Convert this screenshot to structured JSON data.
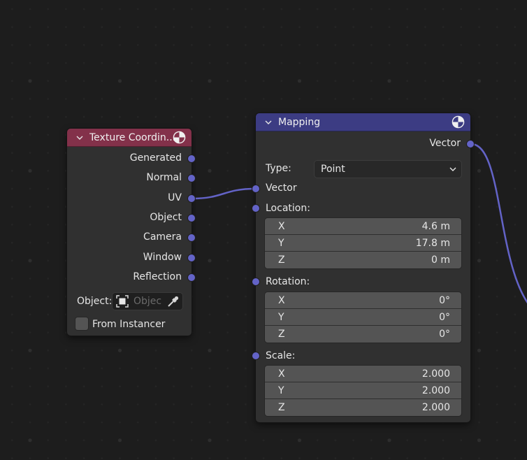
{
  "colors": {
    "background": "#1d1d1d",
    "node_body": "#303030",
    "texture_header": "#83314a",
    "mapping_header": "#3c3c83",
    "socket_vector": "#6363c7",
    "link": "#6363c7"
  },
  "texture_node": {
    "title": "Texture Coordin...",
    "collapse_icon": "chevron-down-icon",
    "preview_icon": "material-preview-icon",
    "outputs": [
      "Generated",
      "Normal",
      "UV",
      "Object",
      "Camera",
      "Window",
      "Reflection"
    ],
    "object_label": "Object:",
    "object_placeholder": "Objec",
    "object_icon": "object-selector-icon",
    "eyedropper_icon": "eyedropper-icon",
    "from_instancer_label": "From Instancer",
    "from_instancer_checked": false
  },
  "mapping_node": {
    "title": "Mapping",
    "collapse_icon": "chevron-down-icon",
    "preview_icon": "material-preview-icon",
    "output_vector": "Vector",
    "type_label": "Type:",
    "type_value": "Point",
    "input_vector": "Vector",
    "location": {
      "label": "Location:",
      "fields": [
        {
          "axis": "X",
          "value": "4.6 m"
        },
        {
          "axis": "Y",
          "value": "17.8 m"
        },
        {
          "axis": "Z",
          "value": "0 m"
        }
      ]
    },
    "rotation": {
      "label": "Rotation:",
      "fields": [
        {
          "axis": "X",
          "value": "0°"
        },
        {
          "axis": "Y",
          "value": "0°"
        },
        {
          "axis": "Z",
          "value": "0°"
        }
      ]
    },
    "scale": {
      "label": "Scale:",
      "fields": [
        {
          "axis": "X",
          "value": "2.000"
        },
        {
          "axis": "Y",
          "value": "2.000"
        },
        {
          "axis": "Z",
          "value": "2.000"
        }
      ]
    }
  },
  "links": [
    {
      "from": "Texture Coordinate.UV",
      "to": "Mapping.Vector"
    },
    {
      "from": "Mapping.Vector",
      "to": "offscreen"
    }
  ]
}
